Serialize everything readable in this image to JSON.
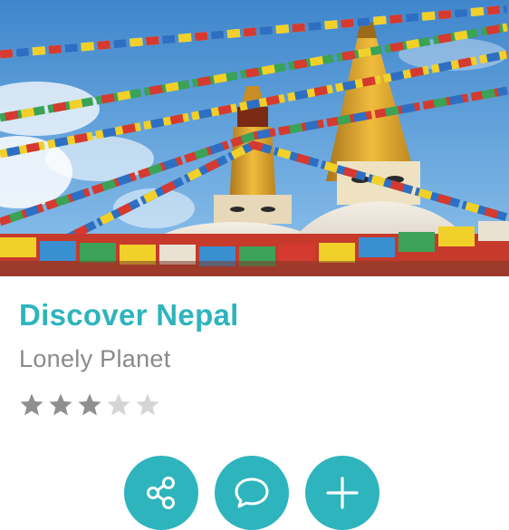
{
  "card": {
    "image_alt": "Boudhanath stupa with prayer flags",
    "title": "Discover Nepal",
    "subtitle": "Lonely Planet",
    "rating": 3,
    "rating_max": 5
  },
  "actions": [
    {
      "icon": "share-icon"
    },
    {
      "icon": "comment-icon"
    },
    {
      "icon": "plus-icon"
    }
  ],
  "colors": {
    "accent": "#2eb4bd",
    "title": "#2eb4bd",
    "subtitle": "#8a8a8a",
    "star_filled": "#8f8f8f",
    "star_empty": "#d5d5d5"
  }
}
